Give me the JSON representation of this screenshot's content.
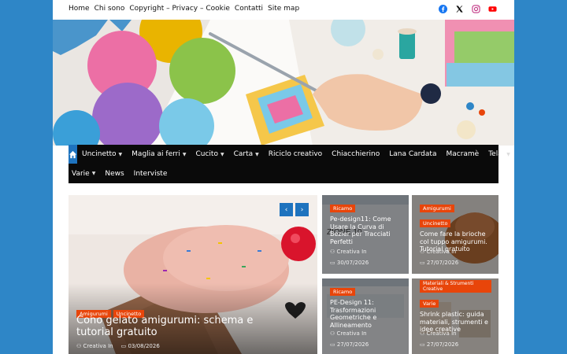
{
  "topbar": {
    "links": [
      "Home",
      "Chi sono",
      "Copyright – Privacy – Cookie",
      "Contatti",
      "Site map"
    ],
    "social_icons": [
      "facebook-icon",
      "x-icon",
      "instagram-icon",
      "youtube-icon"
    ],
    "social_colors": {
      "facebook": "#1877f2",
      "x": "#111111",
      "instagram": "#c13584",
      "youtube": "#ff0000"
    }
  },
  "nav": {
    "row1": [
      {
        "label": "Uncinetto",
        "dropdown": true
      },
      {
        "label": "Maglia ai ferri",
        "dropdown": true
      },
      {
        "label": "Cucito",
        "dropdown": true
      },
      {
        "label": "Carta",
        "dropdown": true
      },
      {
        "label": "Riciclo creativo",
        "dropdown": false
      },
      {
        "label": "Chiacchierino",
        "dropdown": false
      },
      {
        "label": "Lana Cardata",
        "dropdown": false
      },
      {
        "label": "Macramè",
        "dropdown": false
      },
      {
        "label": "Telai",
        "dropdown": true
      }
    ],
    "row2": [
      {
        "label": "Varie",
        "dropdown": true
      },
      {
        "label": "News",
        "dropdown": false
      },
      {
        "label": "Interviste",
        "dropdown": false
      }
    ],
    "caret": "⌄",
    "home_icon": "home-icon"
  },
  "colors": {
    "accent": "#1e73be",
    "tag": "#e8450a",
    "background": "#2e86c7",
    "nav": "#0a0a0a"
  },
  "featured": {
    "tags": [
      "Amigurumi",
      "Uncinetto"
    ],
    "title": "Cono gelato amigurumi: schema e tutorial gratuito",
    "author": "Creativa In",
    "date": "03/08/2026",
    "prev": "‹",
    "next": "›"
  },
  "cards": [
    {
      "tags": [
        "Ricamo"
      ],
      "title": "Pe-design11: Come Usare la Curva di Bezier per Tracciati Perfetti",
      "author": "Creativa In",
      "date": "30/07/2026"
    },
    {
      "tags": [
        "Amigurumi",
        "Uncinetto"
      ],
      "title": "Come fare la brioche col tuppo amigurumi. Tutorial gratuito",
      "author": "Creativa In",
      "date": "27/07/2026"
    },
    {
      "tags": [
        "Ricamo"
      ],
      "title": "PE-Design 11: Trasformazioni Geometriche e Allineamento",
      "author": "Creativa In",
      "date": "27/07/2026"
    },
    {
      "tags": [
        "Materiali & Strumenti Creative",
        "Varie"
      ],
      "title": "Shrink plastic: guida materiali, strumenti e idee creative",
      "author": "Creativa In",
      "date": "27/07/2026"
    }
  ]
}
